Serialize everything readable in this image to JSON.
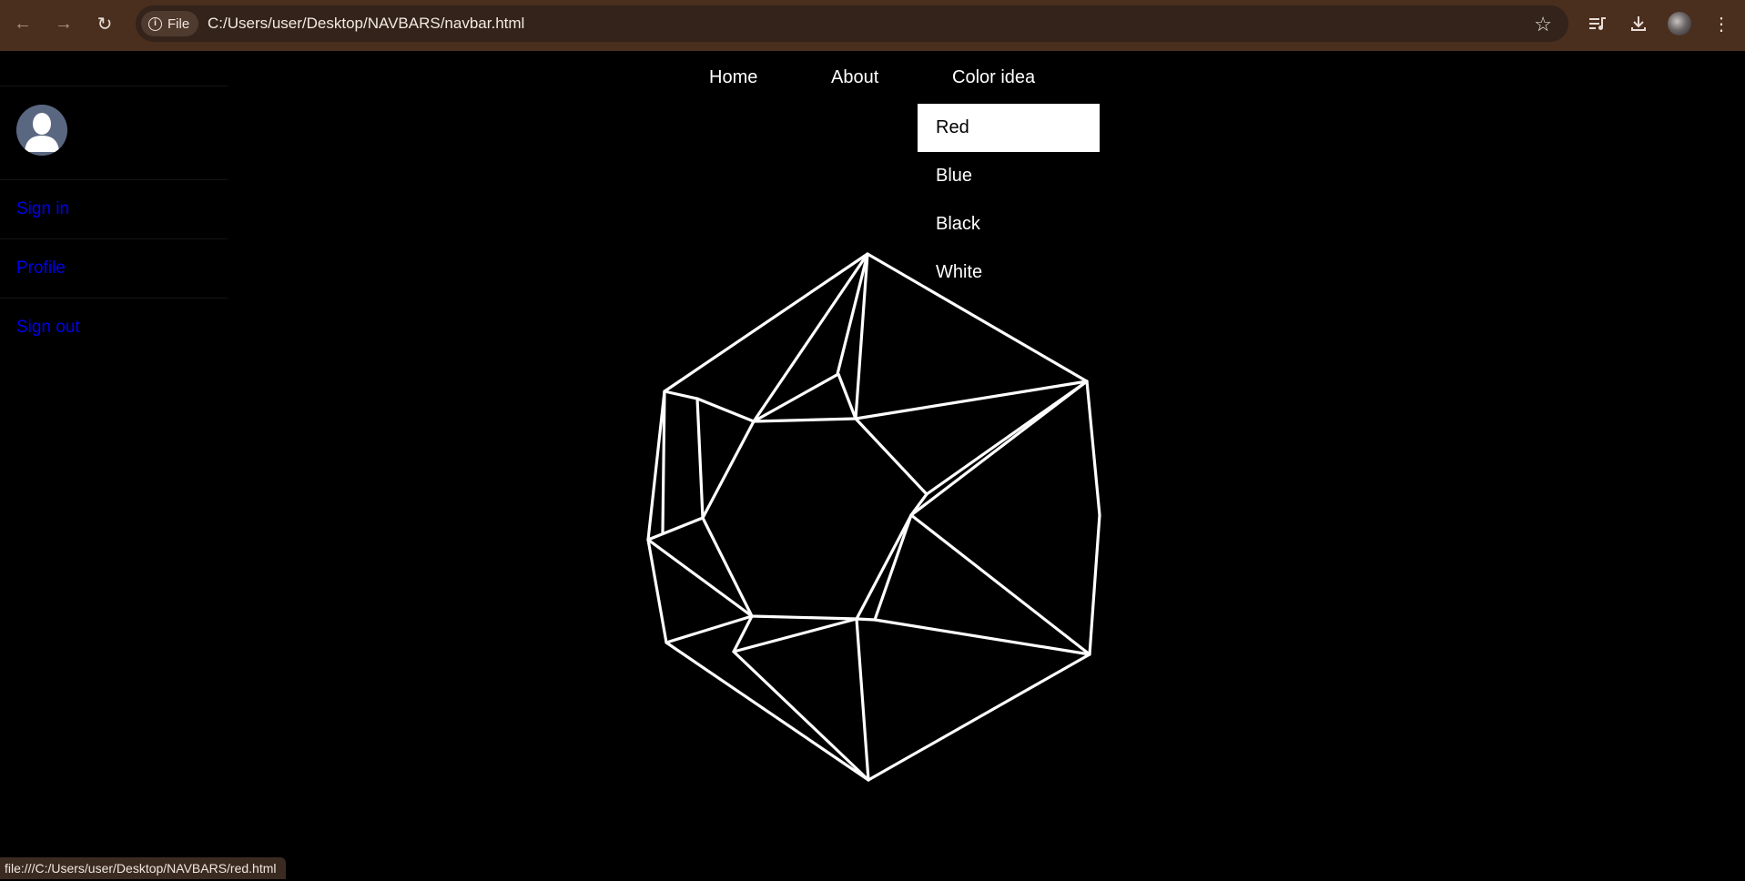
{
  "browser": {
    "address_chip_label": "File",
    "url": "C:/Users/user/Desktop/NAVBARS/navbar.html",
    "status_url": "file:///C:/Users/user/Desktop/NAVBARS/red.html"
  },
  "sidebar": {
    "links": [
      {
        "label": "Sign in"
      },
      {
        "label": "Profile"
      },
      {
        "label": "Sign out"
      }
    ]
  },
  "topnav": {
    "items": [
      {
        "label": "Home"
      },
      {
        "label": "About"
      },
      {
        "label": "Color idea"
      }
    ]
  },
  "dropdown": {
    "items": [
      {
        "label": "Red",
        "highlighted": true
      },
      {
        "label": "Blue"
      },
      {
        "label": "Black"
      },
      {
        "label": "White"
      }
    ]
  },
  "colors": {
    "chrome_bg": "#4a2e1e",
    "page_bg": "#000000",
    "link_color": "#0000ee",
    "dropdown_hover_bg": "#ffffff"
  }
}
